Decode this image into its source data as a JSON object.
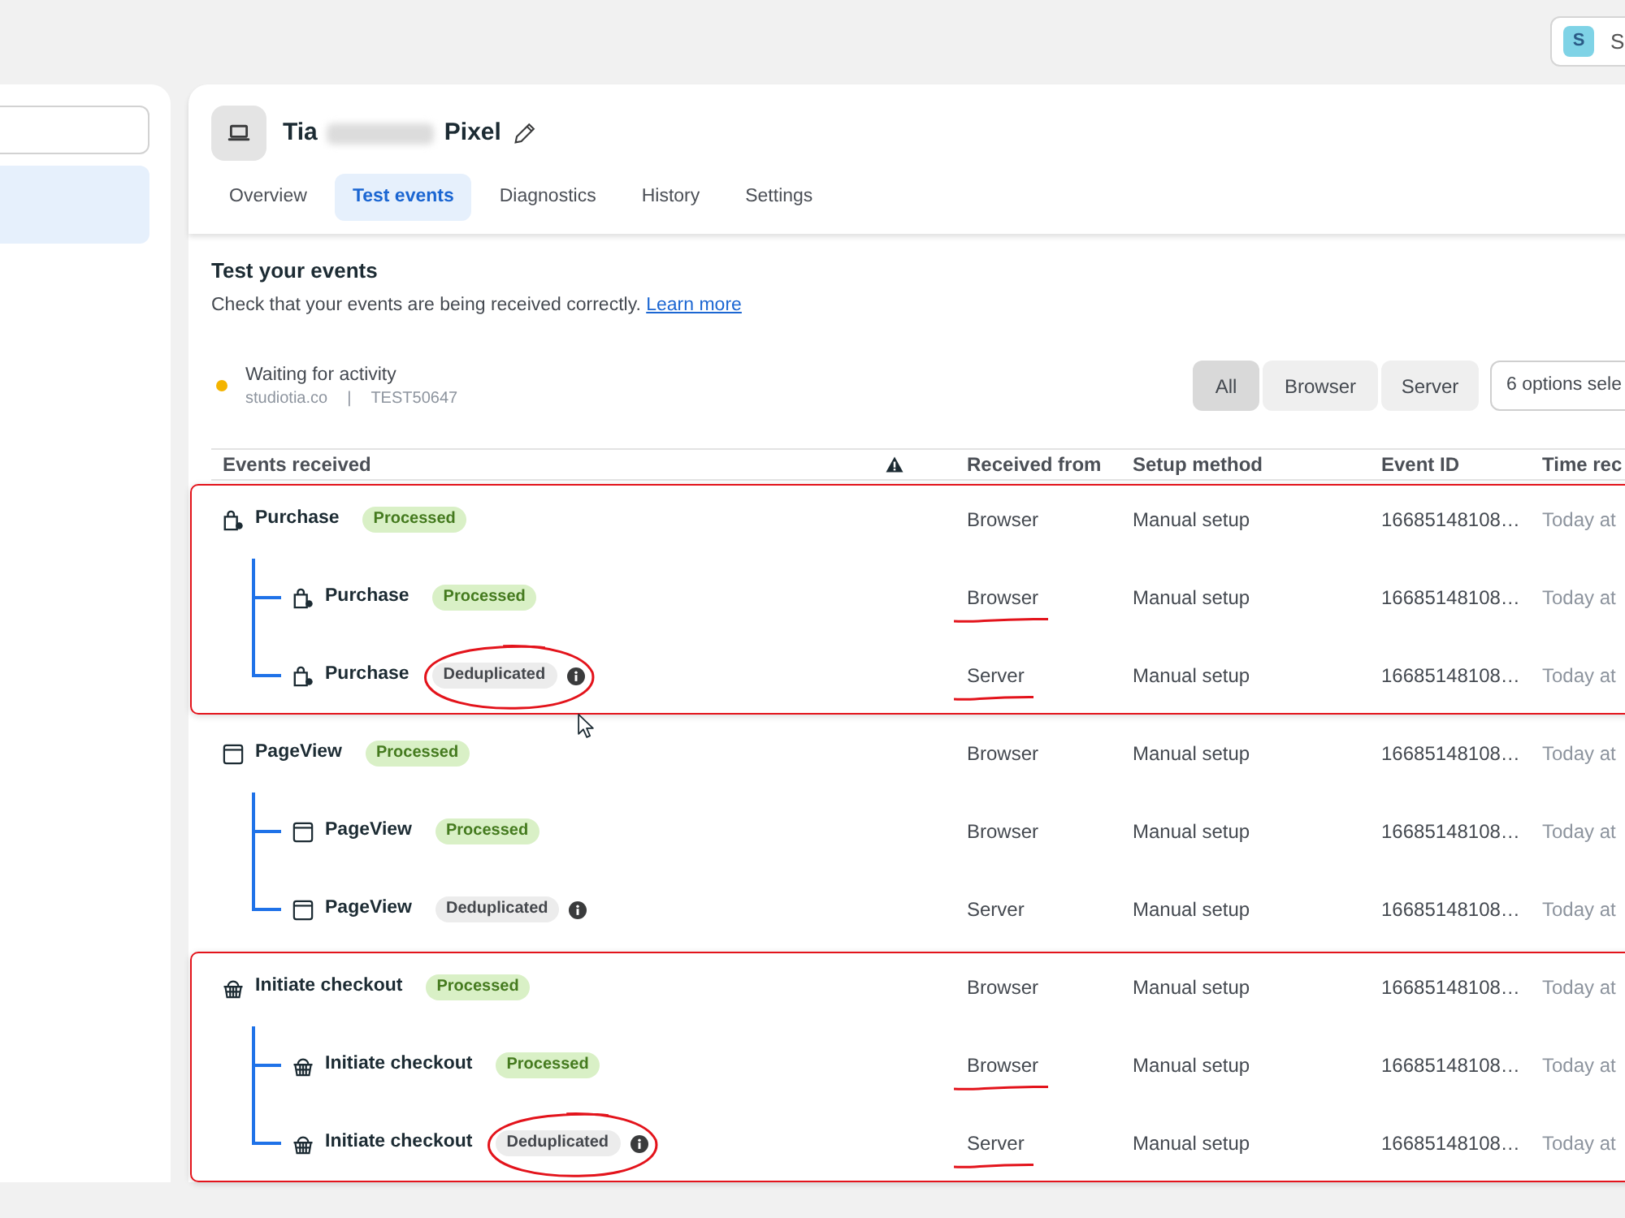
{
  "account": {
    "avatar_letter": "S",
    "name": "S"
  },
  "sidebar": {
    "items": [
      {
        "selected": true
      }
    ]
  },
  "pixel": {
    "name_start": "Tia",
    "name_redacted": true,
    "name_end": "Pixel"
  },
  "tabs": [
    {
      "label": "Overview",
      "selected": false
    },
    {
      "label": "Test events",
      "selected": true
    },
    {
      "label": "Diagnostics",
      "selected": false
    },
    {
      "label": "History",
      "selected": false
    },
    {
      "label": "Settings",
      "selected": false
    }
  ],
  "section": {
    "title": "Test your events",
    "description": "Check that your events are being received correctly.",
    "link": "Learn more"
  },
  "activity": {
    "label": "Waiting for activity",
    "site": "studiotia.co",
    "separator": "|",
    "test_code": "TEST50647"
  },
  "filters": [
    {
      "label": "All",
      "selected": true
    },
    {
      "label": "Browser",
      "selected": false
    },
    {
      "label": "Server",
      "selected": false
    }
  ],
  "event_dropdown": {
    "value": "6 options sele"
  },
  "table": {
    "columns": [
      {
        "kind": "text",
        "label": "Events received"
      },
      {
        "kind": "warning"
      },
      {
        "kind": "text",
        "label": "Received from"
      },
      {
        "kind": "text",
        "label": "Setup method"
      },
      {
        "kind": "text",
        "label": "Event ID"
      },
      {
        "kind": "text",
        "label": "Time rec"
      }
    ],
    "events": [
      {
        "kind": "purchase",
        "name": "Purchase",
        "status": {
          "kind": "processed",
          "label": "Processed"
        },
        "received_from": "Browser",
        "setup_method": "Manual setup",
        "event_id": "16685148108…",
        "time_received": "Today at",
        "annotated": true,
        "source_underlined": false,
        "status_circled": false,
        "children": [
          {
            "kind": "purchase",
            "name": "Purchase",
            "status": {
              "kind": "processed",
              "label": "Processed"
            },
            "received_from": "Browser",
            "setup_method": "Manual setup",
            "event_id": "16685148108…",
            "time_received": "Today at",
            "source_underlined": true,
            "status_circled": false
          },
          {
            "kind": "purchase",
            "name": "Purchase",
            "status": {
              "kind": "deduplicated",
              "label": "Deduplicated"
            },
            "received_from": "Server",
            "setup_method": "Manual setup",
            "event_id": "16685148108…",
            "time_received": "Today at",
            "source_underlined": true,
            "status_circled": true
          }
        ]
      },
      {
        "kind": "pageview",
        "name": "PageView",
        "status": {
          "kind": "processed",
          "label": "Processed"
        },
        "received_from": "Browser",
        "setup_method": "Manual setup",
        "event_id": "16685148108…",
        "time_received": "Today at",
        "annotated": false,
        "source_underlined": false,
        "status_circled": false,
        "children": [
          {
            "kind": "pageview",
            "name": "PageView",
            "status": {
              "kind": "processed",
              "label": "Processed"
            },
            "received_from": "Browser",
            "setup_method": "Manual setup",
            "event_id": "16685148108…",
            "time_received": "Today at",
            "source_underlined": false,
            "status_circled": false
          },
          {
            "kind": "pageview",
            "name": "PageView",
            "status": {
              "kind": "deduplicated",
              "label": "Deduplicated"
            },
            "received_from": "Server",
            "setup_method": "Manual setup",
            "event_id": "16685148108…",
            "time_received": "Today at",
            "source_underlined": false,
            "status_circled": false
          }
        ]
      },
      {
        "kind": "checkout",
        "name": "Initiate checkout",
        "status": {
          "kind": "processed",
          "label": "Processed"
        },
        "received_from": "Browser",
        "setup_method": "Manual setup",
        "event_id": "16685148108…",
        "time_received": "Today at",
        "annotated": true,
        "source_underlined": false,
        "status_circled": false,
        "children": [
          {
            "kind": "checkout",
            "name": "Initiate checkout",
            "status": {
              "kind": "processed",
              "label": "Processed"
            },
            "received_from": "Browser",
            "setup_method": "Manual setup",
            "event_id": "16685148108…",
            "time_received": "Today at",
            "source_underlined": true,
            "status_circled": false
          },
          {
            "kind": "checkout",
            "name": "Initiate checkout",
            "status": {
              "kind": "deduplicated",
              "label": "Deduplicated"
            },
            "received_from": "Server",
            "setup_method": "Manual setup",
            "event_id": "16685148108…",
            "time_received": "Today at",
            "source_underlined": true,
            "status_circled": true
          }
        ]
      }
    ]
  }
}
